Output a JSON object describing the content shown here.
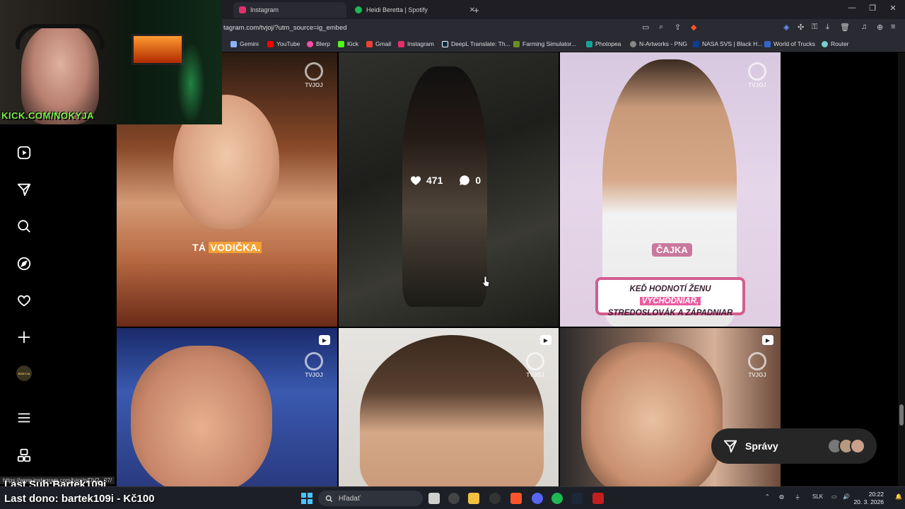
{
  "browser": {
    "tabs": [
      {
        "title": "Instagram",
        "active": true,
        "color": "#e1306c"
      },
      {
        "title": "Heidi Beretta | Spotify",
        "active": false,
        "color": "#1db954"
      }
    ],
    "new_tab": "+",
    "url": "tagram.com/tvjoj/?utm_source=ig_embed",
    "window_controls": [
      "—",
      "❐",
      "✕"
    ],
    "bookmarks": [
      {
        "label": "Gemini",
        "color": "#8ab4f8"
      },
      {
        "label": "YouTube",
        "color": "#ff0000"
      },
      {
        "label": "Blerp",
        "color": "#ff4da6"
      },
      {
        "label": "Kick",
        "color": "#53fc18"
      },
      {
        "label": "Gmail",
        "color": "#ea4335"
      },
      {
        "label": "Instagram",
        "color": "#e1306c"
      },
      {
        "label": "DeepL Translate: Th...",
        "color": "#0f2b46"
      },
      {
        "label": "Farming Simulator...",
        "color": "#6b8e23"
      },
      {
        "label": "Photopea",
        "color": "#18a497"
      },
      {
        "label": "N-Artworks - PNG",
        "color": "#888888"
      },
      {
        "label": "NASA SVS | Black H...",
        "color": "#0b3d91"
      },
      {
        "label": "World of Trucks",
        "color": "#3366cc"
      },
      {
        "label": "Router",
        "color": "#7cc"
      }
    ]
  },
  "sidebar": {
    "items": [
      {
        "name": "reels-icon"
      },
      {
        "name": "send-icon"
      },
      {
        "name": "search-icon"
      },
      {
        "name": "explore-icon"
      },
      {
        "name": "heart-icon"
      },
      {
        "name": "create-icon"
      },
      {
        "name": "profile-avatar"
      },
      {
        "name": "menu-icon"
      },
      {
        "name": "apps-icon"
      }
    ],
    "profile_label": "NOKYJA"
  },
  "grid": {
    "logo_text": "TVJOJ",
    "tile1_caption_plain": "TÁ",
    "tile1_caption_highlight": "VODIČKA.",
    "tile2_likes": "471",
    "tile2_comments": "0",
    "tile3_tag": "ČAJKA",
    "tile3_bubble_line1_a": "KEĎ HODNOTÍ ŽENU",
    "tile3_bubble_line1_b": "VÝCHODNIAR,",
    "tile3_bubble_line2": "STREDOSLOVÁK A ZÁPADNIAR"
  },
  "messages": {
    "label": "Správy"
  },
  "status_bar_url": "https://www.instagram.com/tvjoj/p/DV2...07/",
  "stream": {
    "kick_handle": "KICK.COM/NOKYJA",
    "last_sub": "Last Sub:Bartek109i",
    "last_dono": "Last dono: bartek109i - Kč100"
  },
  "taskbar": {
    "search_placeholder": "Hľadať",
    "language": "SLK",
    "time": "20:22",
    "date": "20. 3. 2026"
  }
}
